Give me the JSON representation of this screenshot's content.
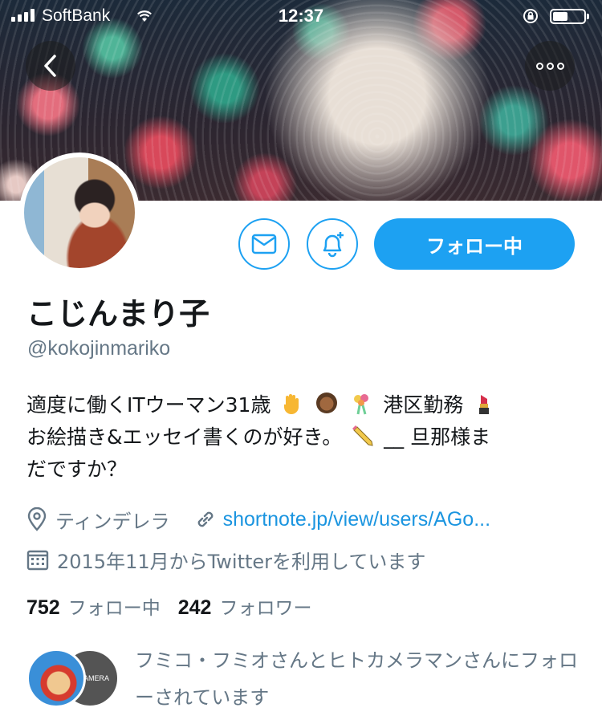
{
  "status_bar": {
    "carrier": "SoftBank",
    "time": "12:37"
  },
  "profile": {
    "display_name": "こじんまり子",
    "handle": "@kokojinmariko",
    "follow_button_label": "フォロー中",
    "bio": {
      "line1_a": "適度に働くITウーマン31歳",
      "line1_b": "港区勤務",
      "line2": "お絵描き&エッセイ書くのが好き。",
      "line2_b": "__ 旦那様ま",
      "line3": "だですか？"
    },
    "location": "ティンデレラ",
    "link": "shortnote.jp/view/users/AGo...",
    "joined": "2015年11月からTwitterを利用しています"
  },
  "stats": {
    "following_count": "752",
    "following_label": "フォロー中",
    "followers_count": "242",
    "followers_label": "フォロワー"
  },
  "followed_by": {
    "text": "フミコ・フミオさんとヒトカメラマンさんにフォローされています",
    "avatar2_label": "CAMERA"
  },
  "colors": {
    "accent": "#1da1f2",
    "secondary_text": "#657786",
    "link": "#1b95e0"
  }
}
